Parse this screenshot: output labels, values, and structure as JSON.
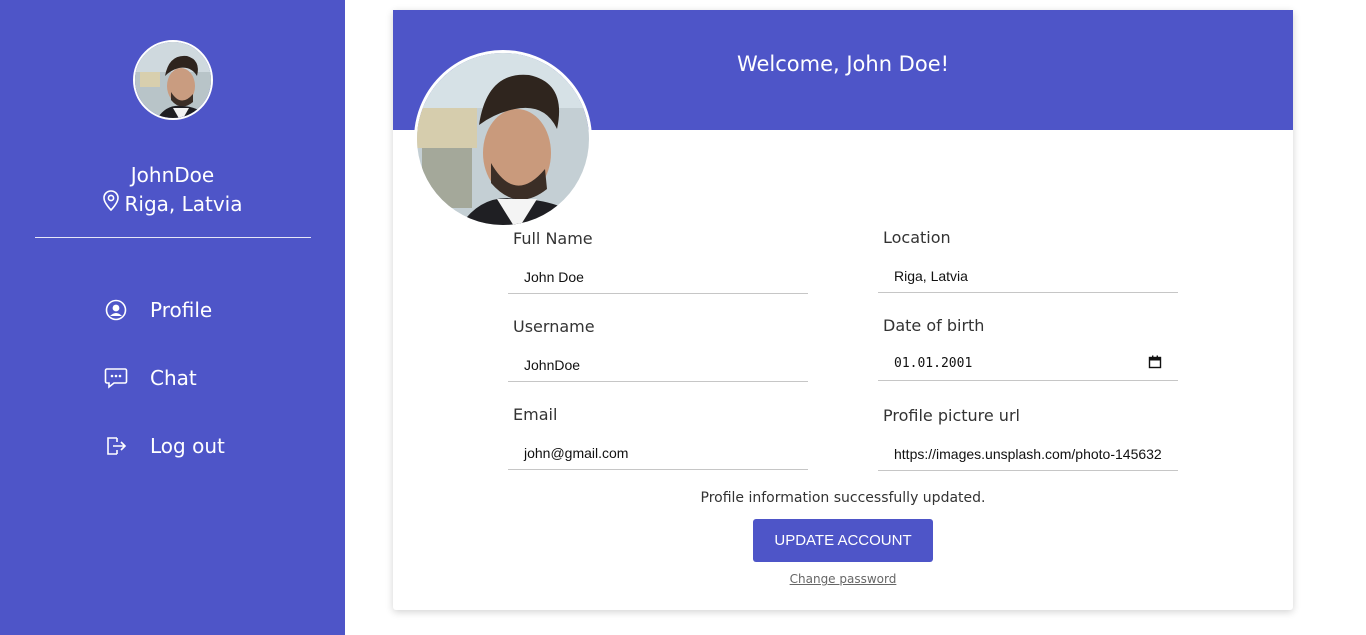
{
  "sidebar": {
    "username": "JohnDoe",
    "location": "Riga, Latvia",
    "nav": [
      {
        "label": "Profile",
        "icon": "user-circle-icon"
      },
      {
        "label": "Chat",
        "icon": "chat-bubble-icon"
      },
      {
        "label": "Log out",
        "icon": "logout-icon"
      }
    ]
  },
  "main": {
    "welcome": "Welcome, John Doe!",
    "fields": {
      "full_name": {
        "label": "Full Name",
        "value": "John Doe"
      },
      "location": {
        "label": "Location",
        "value": "Riga, Latvia"
      },
      "username": {
        "label": "Username",
        "value": "JohnDoe"
      },
      "date_of_birth": {
        "label": "Date of birth",
        "value": "01.01.2001"
      },
      "email": {
        "label": "Email",
        "value": "john@gmail.com"
      },
      "profile_picture_url": {
        "label": "Profile picture url",
        "value": "https://images.unsplash.com/photo-145632"
      }
    },
    "status_message": "Profile information successfully updated.",
    "update_button": "UPDATE ACCOUNT",
    "change_password": "Change password"
  },
  "colors": {
    "accent": "#4e55c8",
    "white": "#ffffff"
  }
}
